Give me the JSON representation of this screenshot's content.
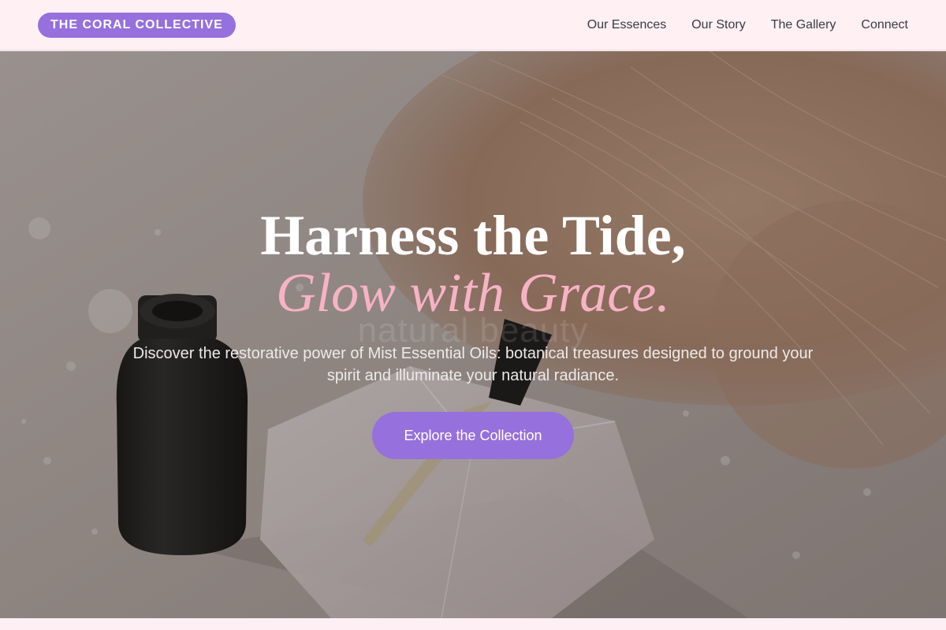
{
  "brand": {
    "name": "THE CORAL COLLECTIVE"
  },
  "nav": {
    "items": [
      {
        "label": "Our Essences"
      },
      {
        "label": "Our Story"
      },
      {
        "label": "The Gallery"
      },
      {
        "label": "Connect"
      }
    ]
  },
  "hero": {
    "headline": "Harness the Tide,",
    "headline_accent": "Glow with Grace.",
    "watermark": "natural beauty",
    "subtitle": "Discover the restorative power of Mist Essential Oils: botanical treasures designed to ground your spirit and illuminate your natural radiance.",
    "cta_label": "Explore the Collection"
  },
  "colors": {
    "accent": "#9670dc",
    "accent_text": "#f7b3c6",
    "nav_background": "#fff0f4"
  }
}
